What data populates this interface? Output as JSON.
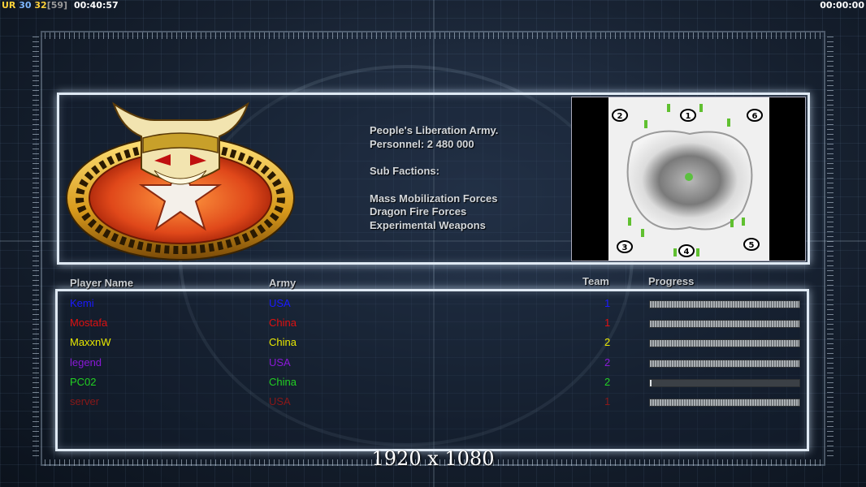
{
  "hud": {
    "ur_label": "UR",
    "val_30": "30",
    "val_32": "32",
    "val_59": "[59]",
    "clock_left": "00:40:57",
    "clock_right": "00:00:00"
  },
  "faction": {
    "line1": "People's Liberation Army.",
    "line2": "Personnel: 2 480 000",
    "subheader": "Sub Factions:",
    "sub1": "Mass Mobilization Forces",
    "sub2": "Dragon Fire Forces",
    "sub3": "Experimental Weapons"
  },
  "minimap": {
    "slots": [
      "1",
      "2",
      "3",
      "4",
      "5",
      "6"
    ]
  },
  "table": {
    "headers": {
      "player": "Player Name",
      "army": "Army",
      "team": "Team",
      "progress": "Progress"
    },
    "rows": [
      {
        "name": "Kemi",
        "army": "USA",
        "team": "1",
        "color": "#1a1aff",
        "progress": 1.0
      },
      {
        "name": "Mostafa",
        "army": "China",
        "team": "1",
        "color": "#e01010",
        "progress": 1.0
      },
      {
        "name": "MaxxnW",
        "army": "China",
        "team": "2",
        "color": "#e8e800",
        "progress": 1.0
      },
      {
        "name": "legend",
        "army": "USA",
        "team": "2",
        "color": "#8a18d8",
        "progress": 1.0
      },
      {
        "name": "PC02",
        "army": "China",
        "team": "2",
        "color": "#22d022",
        "progress": 0.01
      },
      {
        "name": "server",
        "army": "USA",
        "team": "1",
        "color": "#8a1818",
        "progress": 1.0
      }
    ]
  },
  "resolution_label": "1920 x 1080"
}
